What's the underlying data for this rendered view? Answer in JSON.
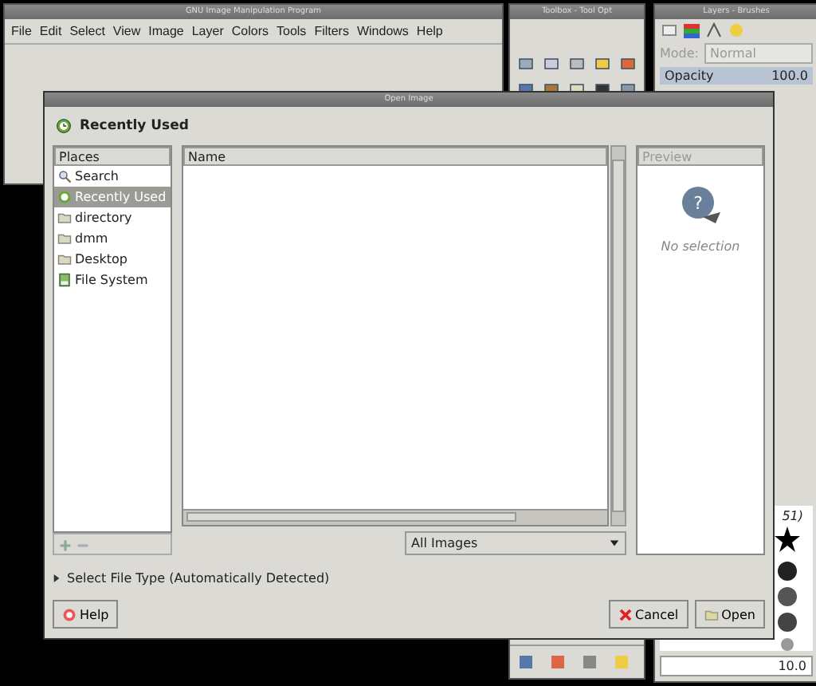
{
  "main_window": {
    "title": "GNU Image Manipulation Program",
    "menu": [
      "File",
      "Edit",
      "Select",
      "View",
      "Image",
      "Layer",
      "Colors",
      "Tools",
      "Filters",
      "Windows",
      "Help"
    ]
  },
  "toolbox": {
    "title": "Toolbox - Tool Opt"
  },
  "layers": {
    "title": "Layers - Brushes",
    "mode_label": "Mode:",
    "mode_value": "Normal",
    "opacity": {
      "label": "Opacity",
      "value": "100.0",
      "level": 1
    },
    "brush_caption": "51)",
    "brush_size": "10.0"
  },
  "dialog": {
    "title": "Open Image",
    "location": "Recently Used",
    "places": {
      "header": "Places",
      "items": [
        {
          "label": "Search",
          "kind": "search",
          "selected": false
        },
        {
          "label": "Recently Used",
          "kind": "recent",
          "selected": true
        },
        {
          "label": "directory",
          "kind": "folder",
          "selected": false
        },
        {
          "label": "dmm",
          "kind": "folder",
          "selected": false
        },
        {
          "label": "Desktop",
          "kind": "folder",
          "selected": false
        },
        {
          "label": "File System",
          "kind": "drive",
          "selected": false
        }
      ]
    },
    "files": {
      "header": "Name"
    },
    "preview": {
      "header": "Preview",
      "icon_glyph": "?",
      "message": "No selection"
    },
    "filter": "All Images",
    "file_type": {
      "label": "Select File Type (Automatically Detected)",
      "expanded": false
    },
    "buttons": [
      {
        "label": "Help",
        "kind": "help"
      },
      {
        "label": "Cancel",
        "kind": "cancel"
      },
      {
        "label": "Open",
        "kind": "open"
      }
    ]
  }
}
